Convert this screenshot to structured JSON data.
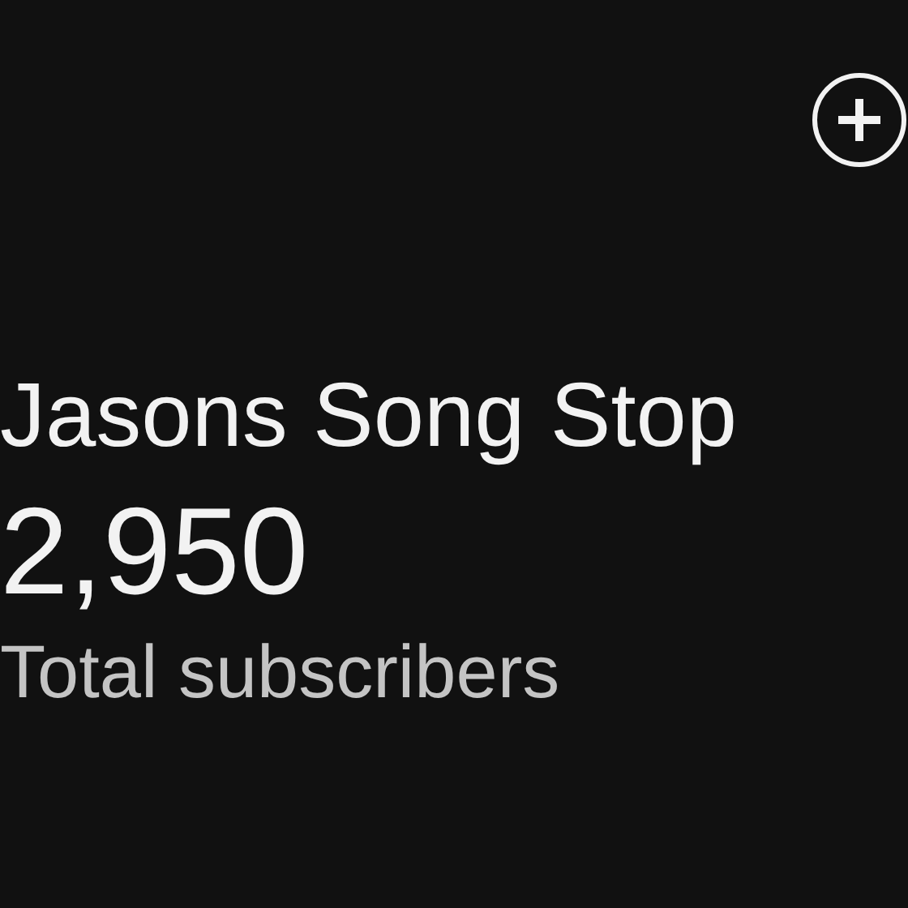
{
  "channel": {
    "name": "Jasons Song Stop",
    "subscriber_count": "2,950",
    "subscriber_label": "Total subscribers"
  }
}
